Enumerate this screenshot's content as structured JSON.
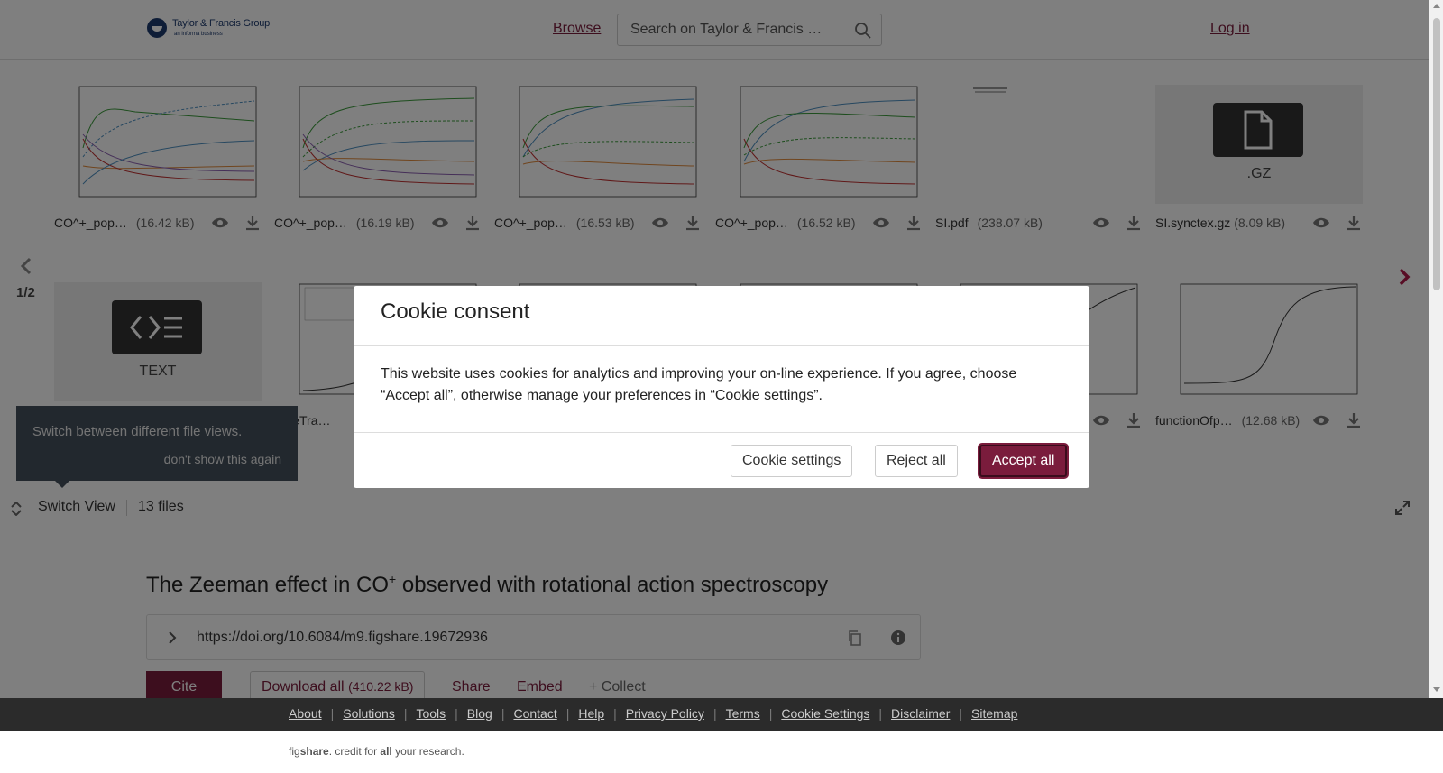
{
  "header": {
    "logo_name": "Taylor & Francis Group",
    "logo_sub": "an informa business",
    "browse_label": "Browse",
    "search_placeholder": "Search on Taylor & Francis …",
    "login_label": "Log in"
  },
  "viewer": {
    "page_indicator": "1/2",
    "row1": [
      {
        "name": "CO^+_pop…",
        "size": "(16.42 kB)"
      },
      {
        "name": "CO^+_pop…",
        "size": "(16.19 kB)"
      },
      {
        "name": "CO^+_pop…",
        "size": "(16.53 kB)"
      },
      {
        "name": "CO^+_pop…",
        "size": "(16.52 kB)"
      },
      {
        "name": "SI.pdf",
        "size": "(238.07 kB)"
      },
      {
        "name": "SI.synctex.gz",
        "size": "(8.09 kB)",
        "type_label": ".GZ"
      }
    ],
    "row2": [
      {
        "type_label": "TEXT"
      },
      {
        "name": "pareTra…"
      },
      {
        "name": "functionOfp…",
        "size": "(12.68 kB)"
      }
    ],
    "tooltip_text": "Switch between different file views.",
    "tooltip_dismiss": "don't show this again",
    "switch_view_label": "Switch View",
    "files_count": "13 files"
  },
  "item": {
    "title_main": "The Zeeman effect in CO",
    "title_sup": "+",
    "title_rest": " observed with rotational action spectroscopy",
    "doi": "https://doi.org/10.6084/m9.figshare.19672936",
    "cite_label": "Cite",
    "download_label": "Download all",
    "download_size": "(410.22 kB)",
    "share_label": "Share",
    "embed_label": "Embed",
    "collect_label": "+ Collect"
  },
  "footer": {
    "links": [
      "About",
      "Solutions",
      "Tools",
      "Blog",
      "Contact",
      "Help",
      "Privacy Policy",
      "Terms",
      "Cookie Settings",
      "Disclaimer",
      "Sitemap"
    ],
    "brand_fig": "fig",
    "brand_share": "share",
    "brand_mid": ". credit for ",
    "brand_all": "all",
    "brand_end": " your research."
  },
  "modal": {
    "title": "Cookie consent",
    "body": "This website uses cookies for analytics and improving your on-line experience. If you agree, choose “Accept all”, otherwise manage your preferences in “Cookie settings”.",
    "settings_label": "Cookie settings",
    "reject_label": "Reject all",
    "accept_label": "Accept all"
  },
  "colors": {
    "brand": "#7a1c3c",
    "footer_bg": "#2b2b2b",
    "tooltip_bg": "#44505c",
    "series": [
      "#4c8fc0",
      "#3a9a3a",
      "#e08a3c",
      "#c03030",
      "#8a5fb0"
    ]
  },
  "icons": [
    "search-icon",
    "eye-icon",
    "download-icon",
    "file-icon",
    "code-icon",
    "chevron-left-icon",
    "chevron-right-icon",
    "switch-view-icon",
    "expand-icon",
    "chevron-right-small-icon",
    "copy-icon",
    "info-icon"
  ]
}
